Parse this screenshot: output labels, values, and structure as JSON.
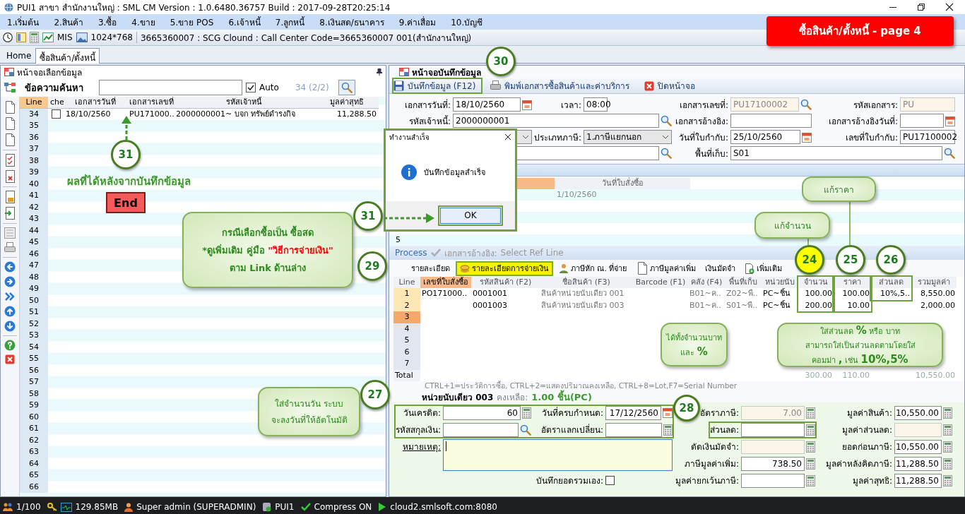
{
  "window": {
    "title": "PUI1 สาขา สำนักงานใหญ่ : SML CM Version : 1.0.6480.36757  Build : 2017-09-28T20:25:14"
  },
  "menu": [
    "1.เริ่มต้น",
    "2.สินค้า",
    "3.ซื้อ",
    "4.ขาย",
    "5.ขาย POS",
    "6.เจ้าหนี้",
    "7.ลูกหนี้",
    "8.เงินสด/ธนาคาร",
    "9.ค่าเสื่อม",
    "10.บัญชี"
  ],
  "quick_bar": {
    "items": [
      {
        "kind": "mis",
        "label": "MIS"
      },
      {
        "kind": "resolution",
        "label": "1024*768"
      }
    ],
    "info": "3665360007 : SCG Clound : Call Center Code=3665360007 001(สำนักงานใหญ่)"
  },
  "tabs": [
    {
      "label": "Home",
      "selected": false
    },
    {
      "label": "ซื้อสินค้า/ตั้งหนี้",
      "selected": true
    }
  ],
  "left_panel": {
    "title": "หน้าจอเลือกข้อมูล",
    "search_label": "ข้อความค้นหา",
    "auto": {
      "label": "Auto",
      "checked": true
    },
    "count": "34 (2/2)",
    "columns": [
      "Line",
      "che",
      "เอกสารวันที่",
      "เอกสารเลขที่",
      "รหัสเจ้าหนี้",
      "มูลค่าสุทธิ"
    ],
    "rows": [
      {
        "line": "34",
        "checked": false,
        "cells": [
          "18/10/2560",
          "PU171000..",
          "2000000001~ บจก ทรัพย์ดำรงกิจ",
          "11,288.50"
        ]
      },
      {
        "line": "35"
      },
      {
        "line": "36"
      },
      {
        "line": "37"
      },
      {
        "line": "38"
      },
      {
        "line": "39"
      },
      {
        "line": "40"
      },
      {
        "line": "41"
      },
      {
        "line": "42"
      },
      {
        "line": "43"
      },
      {
        "line": "44"
      },
      {
        "line": "45"
      },
      {
        "line": "46"
      },
      {
        "line": "47"
      },
      {
        "line": "48"
      },
      {
        "line": "49"
      },
      {
        "line": "50"
      },
      {
        "line": "51"
      },
      {
        "line": "52"
      },
      {
        "line": "53"
      },
      {
        "line": "54"
      },
      {
        "line": "55"
      },
      {
        "line": "56"
      },
      {
        "line": "57"
      },
      {
        "line": "58"
      },
      {
        "line": "59"
      },
      {
        "line": "60"
      },
      {
        "line": "61"
      },
      {
        "line": "62"
      },
      {
        "line": "63"
      },
      {
        "line": "64"
      },
      {
        "line": "65"
      },
      {
        "line": "66"
      }
    ]
  },
  "right_panel": {
    "title": "หน้าจอบันทึกข้อมูล",
    "toolbar": [
      {
        "kind": "save",
        "label": "บันทึกข้อมูล (F12)"
      },
      {
        "kind": "print",
        "label": "พิมพ์เอกสารซื้อสินค้าและค่าบริการ"
      },
      {
        "kind": "close",
        "label": "ปิดหน้าจอ"
      }
    ],
    "form": [
      [
        {
          "kind": "date",
          "label": "เอกสารวันที่:",
          "value": "18/10/2560",
          "disabled": false
        },
        {
          "kind": "time",
          "label": "เวลา:",
          "value": "08:00",
          "disabled": false
        },
        {
          "kind": "lookup",
          "label": "เอกสารเลขที่:",
          "value": "PU17100002",
          "disabled": true
        },
        {
          "kind": "text",
          "label": "รหัสเอกสาร:",
          "value": "PU",
          "disabled": true
        }
      ],
      [
        {
          "kind": "wide-lookup",
          "label": "รหัสเจ้าหนี้:",
          "value": "2000000001",
          "disabled": false
        },
        {
          "kind": "text",
          "label": "เอกสารอ้างอิง:",
          "disabled": false
        },
        {
          "kind": "date",
          "label": "เอกสารอ้างอิงวันที่:",
          "disabled": false
        }
      ],
      [
        {
          "kind": "select",
          "disabled": false
        },
        {
          "kind": "select",
          "label": "ประเภทภาษี:",
          "value": "1.ภาษีแยกนอก",
          "disabled": false
        },
        {
          "kind": "date",
          "label": "วันที่ใบกำกับ:",
          "value": "25/10/2560",
          "disabled": false
        },
        {
          "kind": "text",
          "label": "เลขที่ใบกำกับ:",
          "value": "PU17100002",
          "disabled": false
        }
      ],
      [
        {
          "kind": "wide-lookup",
          "disabled": false
        },
        {
          "kind": "wide-lookup",
          "label": "พื้นที่เก็บ:",
          "value": "S01",
          "disabled": false
        }
      ]
    ],
    "ref_grid": {
      "header": "วันที่ใบสั่งซื้อ",
      "dates": [
        "1/10/2560"
      ],
      "line_label": "5"
    },
    "dialog": {
      "title": "ทำงานสำเร็จ",
      "message": "บันทึกข้อมูลสำเร็จ",
      "button": "OK"
    },
    "process_bar": {
      "label": "Process",
      "reference": "เอกสารอ้างอิง:",
      "action": "Select Ref Line"
    },
    "detail_tabs": [
      {
        "kind": "detail",
        "label": "รายละเอียด",
        "selected": false
      },
      {
        "kind": "payment",
        "label": "รายละเอียดการจ่ายเงิน",
        "selected": true
      },
      {
        "kind": "withholding",
        "label": "ภาษีหัก ณ. ที่จ่าย",
        "selected": false
      },
      {
        "kind": "vat",
        "label": "ภาษีมูลค่าเพิ่ม",
        "selected": false
      },
      {
        "kind": "deposit",
        "label": "เงินมัดจำ",
        "selected": false
      },
      {
        "kind": "more",
        "label": "เพิ่มเติม",
        "selected": false
      }
    ],
    "items": {
      "columns": [
        "Line",
        "เลขที่ใบสั่งซื้อ",
        "รหัสสินค้า (F2)",
        "ชื่อสินค้า (F3)",
        "Barcode (F1)",
        "คลัง (F4)",
        "พื้นที่เก็บ",
        "หน่วยนับ",
        "จำนวน",
        "ราคา",
        "ส่วนลด",
        "รวมมูลค่า"
      ],
      "rows": [
        {
          "line": "1",
          "selected": false,
          "cells": [
            "PO171000..",
            "0001001",
            "สินค้าหน่วยนับเดียว 001",
            null,
            "B01~ค..",
            "Z02~พื..",
            "PC~ชิ้น",
            "100.00",
            "100.00",
            "10%,5..",
            "8,550.00"
          ]
        },
        {
          "line": "2",
          "selected": false,
          "cells": [
            null,
            "0001003",
            "สินค้าหน่วยนับเดียว 003",
            null,
            "B01~ค..",
            "S01~พื..",
            "PC~ชิ้น",
            "200.00",
            "10.00",
            null,
            "2,000.00"
          ]
        },
        {
          "line": "3",
          "selected": true
        },
        {
          "line": "4",
          "selected": false
        },
        {
          "line": "5",
          "selected": false
        },
        {
          "line": "6",
          "selected": false
        },
        {
          "line": "7",
          "selected": false
        }
      ],
      "total": {
        "label": "Total",
        "quantity": "300.00",
        "price": "110.00",
        "amount": "10,550.00"
      }
    },
    "hint": "CTRL+1=ประวัติการซื้อ, CTRL+2=แสดงปริมาณคงเหลือ, CTRL+8=Lot,F7=Serial Number",
    "item_status": {
      "item": "หน่วยนับเดียว 003",
      "label": "คงเหลือ:",
      "value": "1.00 ชิ้น(PC)"
    },
    "bottom": {
      "payment": [
        [
          {
            "kind": "number",
            "label": "วันเครดิต:",
            "value": "60",
            "disabled": false
          },
          {
            "kind": "date",
            "label": "วันที่ครบกำหนด:",
            "value": "17/12/2560",
            "disabled": false
          }
        ],
        [
          {
            "kind": "lookup",
            "label": "รหัสสกุลเงิน:",
            "disabled": false
          },
          {
            "kind": "number",
            "label": "อัตราแลกเปลี่ยน:",
            "disabled": false
          }
        ]
      ],
      "remark": {
        "label": "หมายเหตุ:"
      },
      "manual_total": {
        "label": "บันทึกยอดรวมเอง:",
        "checked": false
      },
      "tax": [
        {
          "label": "อัตราภาษี:",
          "value": "7.00",
          "disabled": true
        },
        {
          "label": "ส่วนลด:",
          "disabled": false
        },
        {
          "label": "ตัดเงินมัดจำ:",
          "disabled": true
        },
        {
          "label": "ภาษีมูลค่าเพิ่ม:",
          "value": "738.50",
          "disabled": false
        },
        {
          "label": "มูลค่ายกเว้นภาษี:",
          "disabled": false
        }
      ],
      "totals": [
        {
          "label": "มูลค่าสินค้า:",
          "value": "10,550.00",
          "disabled": false
        },
        {
          "label": "มูลค่าส่วนลด:",
          "disabled": true
        },
        {
          "label": "ยอดก่อนภาษี:",
          "value": "10,550.00",
          "disabled": false
        },
        {
          "label": "มูลค่าหลังคิดภาษี:",
          "value": "11,288.50",
          "disabled": false
        },
        {
          "label": "มูลค่าสุทธิ:",
          "value": "11,288.50",
          "disabled": false
        }
      ]
    }
  },
  "status_bar": [
    {
      "kind": "users",
      "text": "1/100"
    },
    {
      "kind": "memory",
      "text": "129.85MB"
    },
    {
      "kind": "user",
      "text": "Super admin (SUPERADMIN)"
    },
    {
      "kind": "database",
      "text": "PUI1"
    },
    {
      "kind": "check",
      "text": "Compress ON"
    },
    {
      "kind": "server",
      "text": "cloud2.smlsoft.com:8080"
    }
  ],
  "annotations": {
    "banner": "ซื้อสินค้า/ตั้งหนี้ - page 4",
    "result_note": "ผลที่ได้หลังจากบันทึกข้อมูล",
    "end_button": "End",
    "markers": [
      {
        "number": "30",
        "color": "#ffffff"
      },
      {
        "number": "31",
        "color": "#ffffff"
      },
      {
        "number": "31",
        "color": "#ffffff"
      },
      {
        "number": "29",
        "color": "#ffffff"
      },
      {
        "number": "24",
        "color": "#ffff00"
      },
      {
        "number": "25",
        "color": "#ffffff"
      },
      {
        "number": "26",
        "color": "#ffffff"
      },
      {
        "number": "27",
        "color": "#ffffff"
      },
      {
        "number": "28",
        "color": "#ffffff"
      }
    ],
    "callouts": [
      {
        "kind": "note",
        "lines": [
          "แก้ราคา"
        ]
      },
      {
        "kind": "reference",
        "lines": [
          "กรณีเลือกซื้อเป็น ซื้อสด",
          "*ดูเพิ่มเติม  คู่มือ **\"วิธีการจ่ายเงิน\"**",
          "ตาม Link ด้านล่าง"
        ]
      },
      {
        "kind": "note",
        "lines": [
          "แก้จำนวน"
        ]
      },
      {
        "kind": "example",
        "lines": [
          "ได้ทั้งจำนวนบาท",
          "และ **%**"
        ]
      },
      {
        "kind": "example",
        "lines": [
          "ใส่ส่วนลด **%** หรือ บาท",
          "สามารถใส่เป็นส่วนลดตามโดยใส่",
          "คอมม่า **,** เช่น **10%,5%**"
        ]
      },
      {
        "kind": "note",
        "lines": [
          "ใส่จำนวนวัน ระบบ",
          "จะลงวันที่ให้อัตโนมัติ"
        ]
      }
    ]
  }
}
